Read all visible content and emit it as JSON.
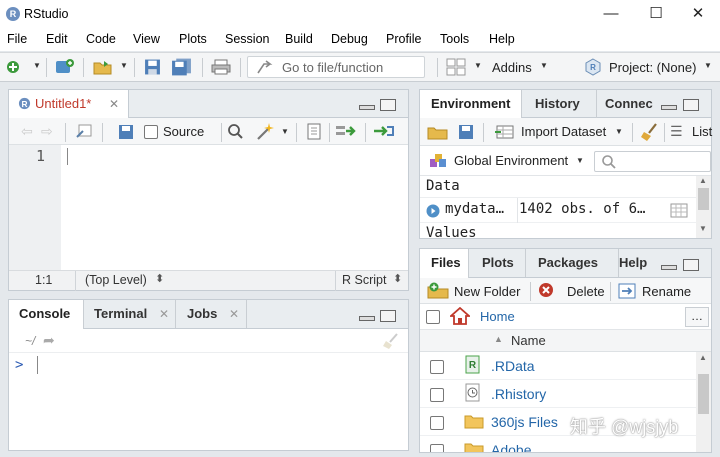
{
  "window": {
    "title": "RStudio",
    "minimize_glyph": "—",
    "maximize_glyph": "☐",
    "close_glyph": "✕"
  },
  "menu": [
    "File",
    "Edit",
    "Code",
    "View",
    "Plots",
    "Session",
    "Build",
    "Debug",
    "Profile",
    "Tools",
    "Help"
  ],
  "toolbar": {
    "goto_placeholder": "Go to file/function",
    "addins_label": "Addins",
    "project_label": "Project: (None)"
  },
  "editor": {
    "tab_label": "Untitled1*",
    "source_label": "Source",
    "line_number": "1",
    "position": "1:1",
    "scope": "(Top Level)",
    "filetype": "R Script"
  },
  "console": {
    "tabs": [
      "Console",
      "Terminal",
      "Jobs"
    ],
    "path": "~/",
    "prompt": ">"
  },
  "environment": {
    "tabs": [
      "Environment",
      "History",
      "Connec"
    ],
    "import_label": "Import Dataset",
    "list_label": "List",
    "scope_label": "Global Environment",
    "section_data": "Data",
    "section_values": "Values",
    "rows": [
      {
        "name": "mydata…",
        "value": "1402 obs. of 6…"
      }
    ]
  },
  "files": {
    "tabs": [
      "Files",
      "Plots",
      "Packages",
      "Help"
    ],
    "new_folder_label": "New Folder",
    "delete_label": "Delete",
    "rename_label": "Rename",
    "home_label": "Home",
    "more_label": "…",
    "column_name": "Name",
    "items": [
      {
        "name": ".RData",
        "icon": "r-data-icon"
      },
      {
        "name": ".Rhistory",
        "icon": "history-icon"
      },
      {
        "name": "360js Files",
        "icon": "folder-icon"
      },
      {
        "name": "Adobe",
        "icon": "folder-icon"
      }
    ]
  },
  "watermark": "知乎 @wjsjyb",
  "colors": {
    "accent_blue": "#2366a8",
    "tab_bg": "#e9edf0",
    "pane_border": "#c5ccd3",
    "editor_tab_text": "#c0392b",
    "folder": "#f2c55c",
    "green": "#4aa34a"
  }
}
